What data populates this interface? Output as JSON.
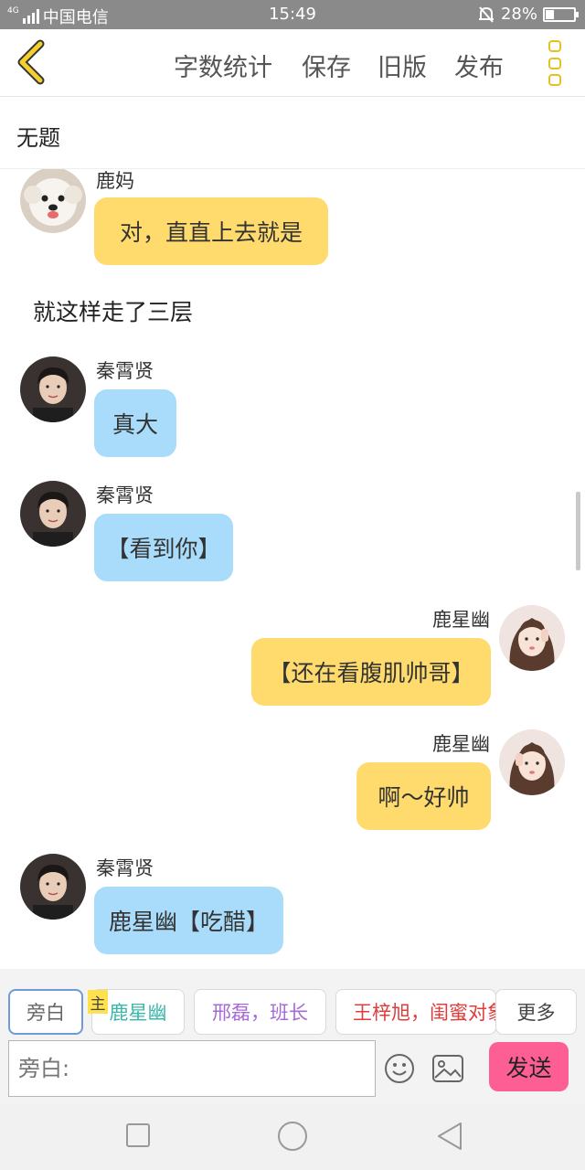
{
  "status_bar": {
    "network": "4G",
    "carrier": "中国电信",
    "time": "15:49",
    "battery": "28%",
    "battery_level": 0.28
  },
  "toolbar": {
    "word_count": "字数统计",
    "save": "保存",
    "old_version": "旧版",
    "publish": "发布"
  },
  "document": {
    "title": "无题"
  },
  "chat": {
    "m1": {
      "name": "鹿妈",
      "text": "对，直直上去就是"
    },
    "narration": "就这样走了三层",
    "m2": {
      "name": "秦霄贤",
      "text": "真大"
    },
    "m3": {
      "name": "秦霄贤",
      "text": "【看到你】"
    },
    "m4": {
      "name": "鹿星幽",
      "text": "【还在看腹肌帅哥】"
    },
    "m5": {
      "name": "鹿星幽",
      "text": "啊～好帅"
    },
    "m6": {
      "name": "秦霄贤",
      "text": "鹿星幽【吃醋】"
    }
  },
  "roles": {
    "narrator": "旁白",
    "host_tag": "主",
    "r1": "鹿星幽",
    "r2": "邢磊，班长",
    "r3": "王梓旭，闺蜜对象",
    "more": "更多"
  },
  "input": {
    "placeholder": "旁白:",
    "send": "发送"
  },
  "colors": {
    "accent_yellow": "#ffdb6e",
    "bubble_blue": "#a8dcfa",
    "send_pink": "#fd5f94",
    "role_teal": "#3bb7a8",
    "role_purple": "#a66ad8",
    "role_red": "#e03c3c"
  },
  "icons": [
    "signal-icon",
    "mute-bell-icon",
    "battery-icon",
    "back-chevron-icon",
    "more-menu-icon",
    "emoji-icon",
    "image-icon",
    "square-nav-icon",
    "circle-nav-icon",
    "triangle-back-nav-icon"
  ]
}
